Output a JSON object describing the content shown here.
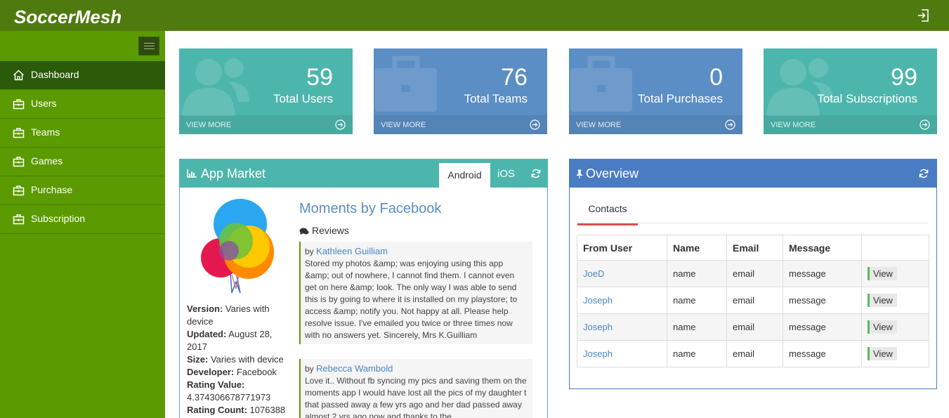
{
  "brand": "SoccerMesh",
  "sidebar": {
    "items": [
      {
        "label": "Dashboard",
        "icon": "home-icon"
      },
      {
        "label": "Users",
        "icon": "briefcase-icon"
      },
      {
        "label": "Teams",
        "icon": "briefcase-icon"
      },
      {
        "label": "Games",
        "icon": "briefcase-icon"
      },
      {
        "label": "Purchase",
        "icon": "briefcase-icon"
      },
      {
        "label": "Subscription",
        "icon": "briefcase-icon"
      }
    ]
  },
  "stats": [
    {
      "value": "59",
      "label": "Total Users",
      "link": "VIEW MORE",
      "color": "#4db6ac",
      "icon": "users-icon"
    },
    {
      "value": "76",
      "label": "Total Teams",
      "link": "VIEW MORE",
      "color": "#5b8ec4",
      "icon": "briefcase-icon"
    },
    {
      "value": "0",
      "label": "Total Purchases",
      "link": "VIEW MORE",
      "color": "#5b8ec4",
      "icon": "briefcase-icon"
    },
    {
      "value": "99",
      "label": "Total Subscriptions",
      "link": "VIEW MORE",
      "color": "#4db6ac",
      "icon": "users-icon"
    }
  ],
  "app_market": {
    "title": "App Market",
    "tabs": [
      "Android",
      "iOS"
    ],
    "active_tab": "Android",
    "app": {
      "name": "Moments by Facebook",
      "version_label": "Version:",
      "version": "Varies with device",
      "updated_label": "Updated:",
      "updated": "August 28, 2017",
      "size_label": "Size:",
      "size": "Varies with device",
      "developer_label": "Developer:",
      "developer": "Facebook",
      "rating_value_label": "Rating Value:",
      "rating_value": "4.374306678771973",
      "rating_count_label": "Rating Count:",
      "rating_count": "1076388"
    },
    "reviews_heading": "Reviews",
    "reviews": [
      {
        "by": "by",
        "author": "Kathleen Guilliam",
        "text": "Stored my photos &amp; was enjoying using this app &amp; out of nowhere, I cannot find them. I cannot even get on here &amp; look. The only way I was able to send this is by going to where it is installed on my playstore; to access &amp; notify you. Not happy at all. Please help resolve issue. I've emailed you twice or three times now with no answers yet. Sincerely, Mrs K.Guilliam"
      },
      {
        "by": "by",
        "author": "Rebecca Wambold",
        "text": "Love it.. Without fb syncing my pics and saving them on the moments app I would have lost all the pics of my daughter t that passed away a few yrs ago and her dad passed away almost 2 yrs ago now and thanks to the"
      }
    ]
  },
  "overview": {
    "title": "Overview",
    "tab": "Contacts",
    "columns": [
      "From User",
      "Name",
      "Email",
      "Message",
      ""
    ],
    "rows": [
      {
        "from": "JoeD",
        "name": "name",
        "email": "email",
        "message": "message",
        "action": "View"
      },
      {
        "from": "Joseph",
        "name": "name",
        "email": "email",
        "message": "message",
        "action": "View"
      },
      {
        "from": "Joseph",
        "name": "name",
        "email": "email",
        "message": "message",
        "action": "View"
      },
      {
        "from": "Joseph",
        "name": "name",
        "email": "email",
        "message": "message",
        "action": "View"
      }
    ]
  }
}
